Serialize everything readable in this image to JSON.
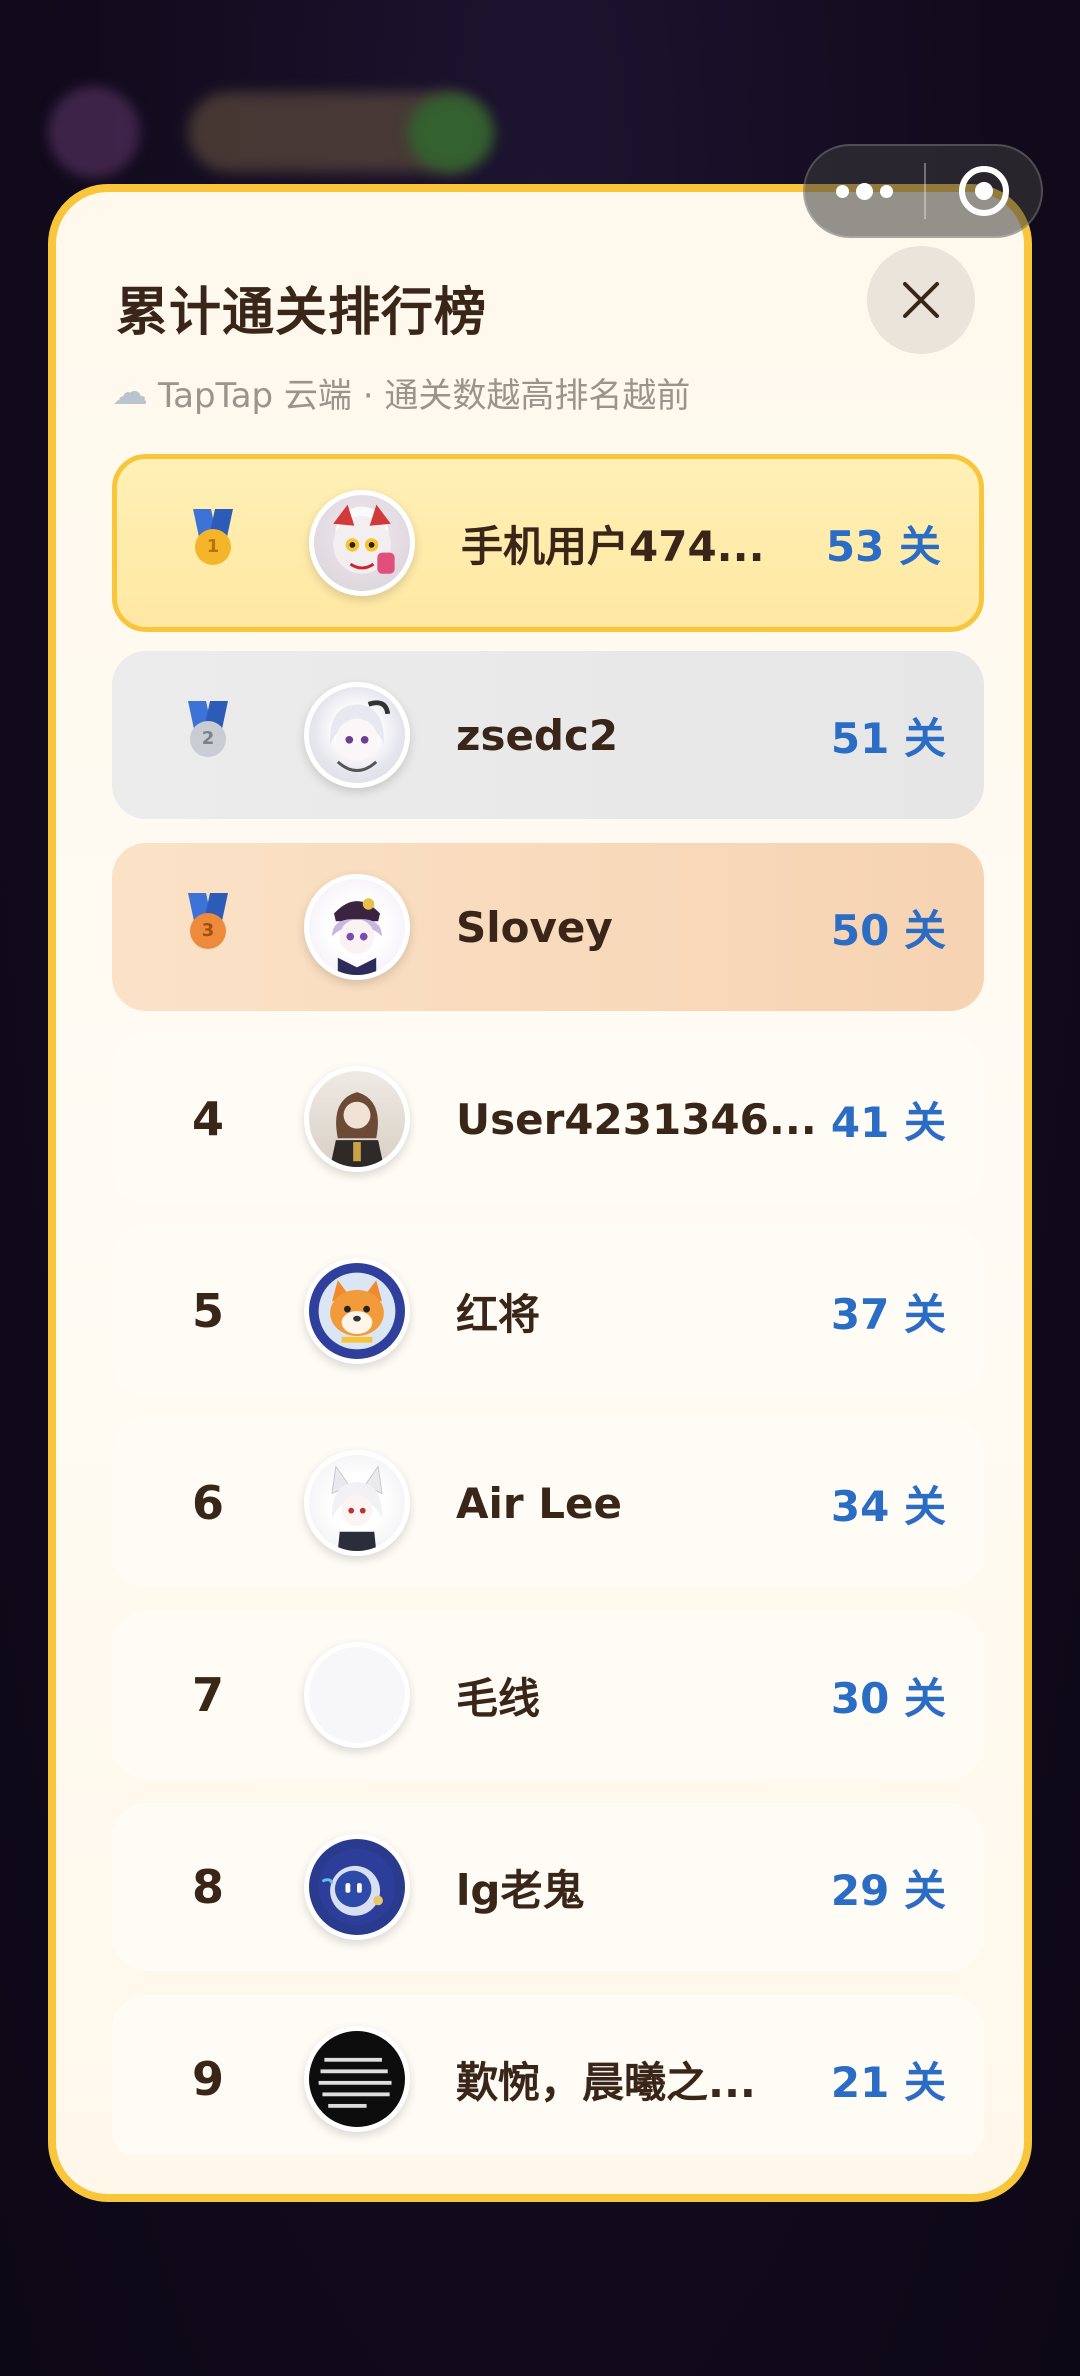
{
  "modal": {
    "title": "累计通关排行榜",
    "subtitle": "TapTap 云端 · 通关数越高排名越前",
    "close_icon": "close-icon",
    "cloud_icon": "cloud-icon"
  },
  "capsule": {
    "more_icon": "more-dots-icon",
    "close_icon": "target-close-icon"
  },
  "colors": {
    "accent_border": "#f8c53b",
    "score": "#2b6cc4",
    "text": "#3a2519"
  },
  "leaderboard": [
    {
      "rank": "1",
      "medal": "gold-medal-icon",
      "name": "手机用户474...",
      "score": "53 关"
    },
    {
      "rank": "2",
      "medal": "silver-medal-icon",
      "name": "zsedc2",
      "score": "51 关"
    },
    {
      "rank": "3",
      "medal": "bronze-medal-icon",
      "name": "Slovey",
      "score": "50 关"
    },
    {
      "rank": "4",
      "name": "User4231346...",
      "score": "41 关"
    },
    {
      "rank": "5",
      "name": "红将",
      "score": "37 关"
    },
    {
      "rank": "6",
      "name": "Air Lee",
      "score": "34 关"
    },
    {
      "rank": "7",
      "name": "毛线",
      "score": "30 关"
    },
    {
      "rank": "8",
      "name": "lg老鬼",
      "score": "29 关"
    },
    {
      "rank": "9",
      "name": "歎惋，晨曦之...",
      "score": "21 关"
    }
  ]
}
